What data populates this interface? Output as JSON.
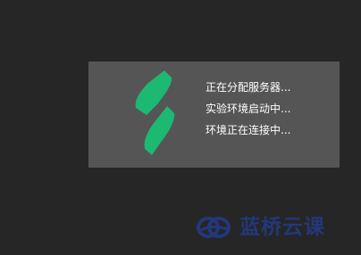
{
  "loading": {
    "logo_icon": "green-slash-logo-icon",
    "logo_color": "#1db872",
    "status_lines": [
      "正在分配服务器...",
      "实验环境启动中...",
      "环境正在连接中..."
    ]
  },
  "brand": {
    "icon": "blue-bridge-logo-icon",
    "name": "蓝桥云课",
    "color": "#24377a"
  }
}
